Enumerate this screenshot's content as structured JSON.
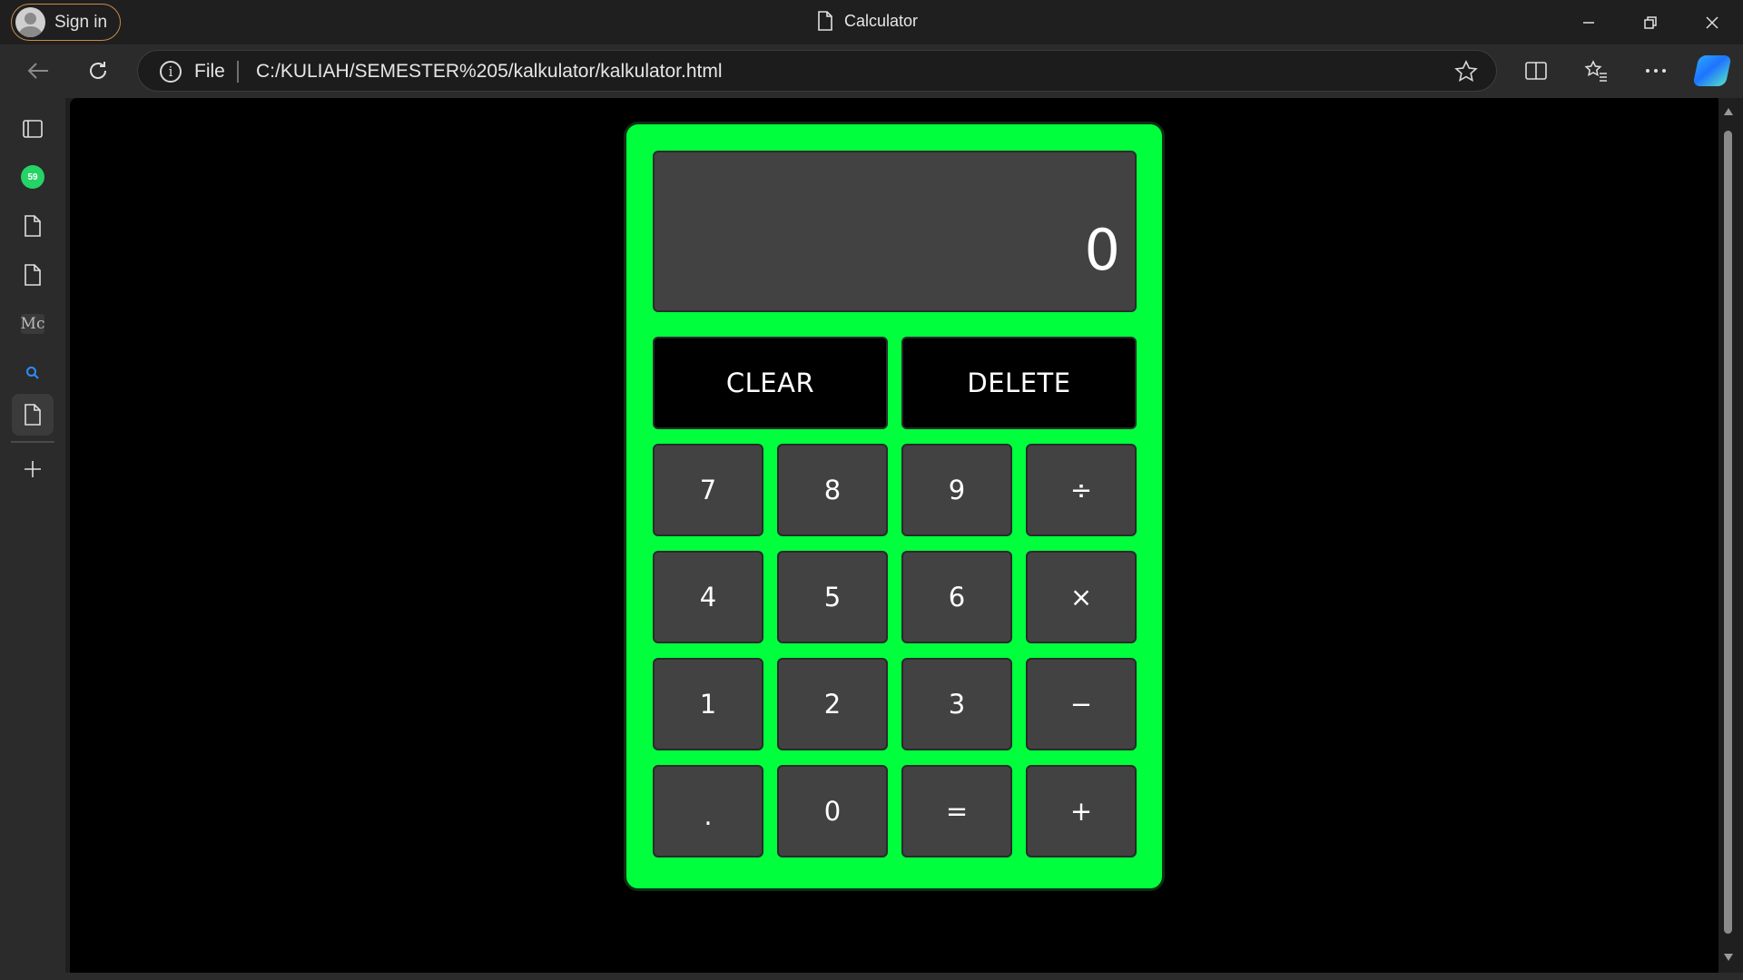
{
  "browser": {
    "signin_label": "Sign in",
    "tab_title": "Calculator",
    "file_label": "File",
    "url": "C:/KULIAH/SEMESTER%205/kalkulator/kalkulator.html",
    "whatsapp_badge": "59",
    "sidebar_mc_label": "Mc"
  },
  "calculator": {
    "display": "0",
    "clear_label": "CLEAR",
    "delete_label": "DELETE",
    "keys": {
      "k7": "7",
      "k8": "8",
      "k9": "9",
      "div": "÷",
      "k4": "4",
      "k5": "5",
      "k6": "6",
      "mul": "×",
      "k1": "1",
      "k2": "2",
      "k3": "3",
      "sub": "−",
      "dot": ".",
      "k0": "0",
      "eq": "=",
      "add": "+"
    }
  },
  "colors": {
    "calculator_body": "#00ff3c",
    "key_bg": "#424242",
    "wide_key_bg": "#000000",
    "page_bg": "#000000"
  }
}
